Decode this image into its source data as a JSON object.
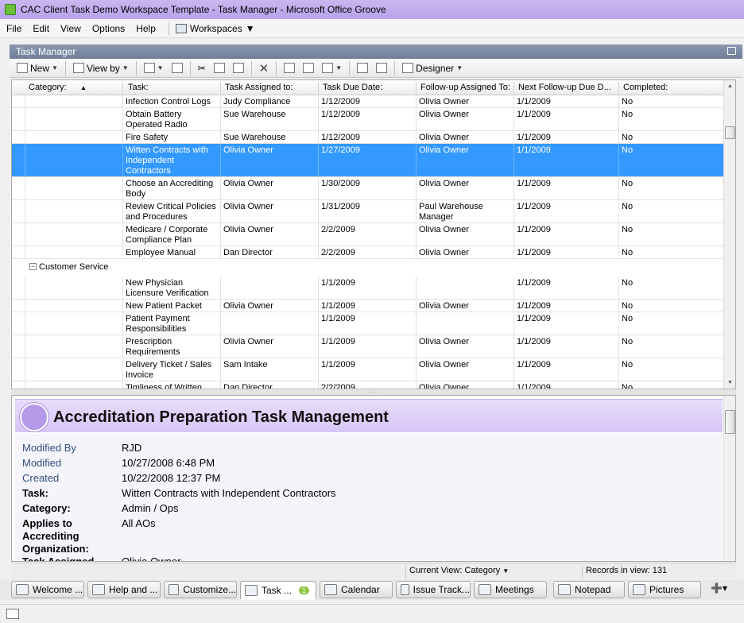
{
  "window": {
    "title": "CAC Client Task Demo Workspace Template - Task Manager - Microsoft Office Groove"
  },
  "menu": {
    "items": [
      "File",
      "Edit",
      "View",
      "Options",
      "Help"
    ],
    "workspaces": "Workspaces"
  },
  "tool": {
    "title": "Task Manager"
  },
  "toolbar": {
    "new_label": "New",
    "viewby_label": "View by",
    "designer_label": "Designer"
  },
  "columns": [
    "Category:",
    "Task:",
    "Task Assigned to:",
    "Task Due Date:",
    "Follow-up Assigned To:",
    "Next Follow-up Due D...",
    "Completed:"
  ],
  "rows_a": [
    {
      "task": "Infection Control Logs",
      "assigned": "Judy Compliance",
      "due": "1/12/2009",
      "followup": "Olivia Owner",
      "next": "1/1/2009",
      "completed": "No"
    },
    {
      "task": "Obtain Battery Operated Radio",
      "assigned": "Sue Warehouse",
      "due": "1/12/2009",
      "followup": "Olivia Owner",
      "next": "1/1/2009",
      "completed": "No"
    },
    {
      "task": "Fire Safety",
      "assigned": "Sue Warehouse",
      "due": "1/12/2009",
      "followup": "Olivia Owner",
      "next": "1/1/2009",
      "completed": "No"
    },
    {
      "task": "Witten Contracts with Independent Contractors",
      "assigned": "Olivia Owner",
      "due": "1/27/2009",
      "followup": "Olivia Owner",
      "next": "1/1/2009",
      "completed": "No"
    },
    {
      "task": "Choose an Accrediting Body",
      "assigned": "Olivia Owner",
      "due": "1/30/2009",
      "followup": "Olivia Owner",
      "next": "1/1/2009",
      "completed": "No"
    },
    {
      "task": "Review Critical Policies and Procedures",
      "assigned": "Olivia Owner",
      "due": "1/31/2009",
      "followup": "Paul Warehouse Manager",
      "next": "1/1/2009",
      "completed": "No"
    },
    {
      "task": "Medicare / Corporate Compliance Plan",
      "assigned": "Olivia Owner",
      "due": "2/2/2009",
      "followup": "Olivia Owner",
      "next": "1/1/2009",
      "completed": "No"
    },
    {
      "task": "Employee Manual",
      "assigned": "Dan Director",
      "due": "2/2/2009",
      "followup": "Olivia Owner",
      "next": "1/1/2009",
      "completed": "No"
    }
  ],
  "group": {
    "label": "Customer Service",
    "toggle": "−"
  },
  "rows_b": [
    {
      "task": "New Physician Licensure Verification",
      "assigned": "",
      "due": "1/1/2009",
      "followup": "",
      "next": "1/1/2009",
      "completed": "No"
    },
    {
      "task": "New Patient Packet",
      "assigned": "Olivia Owner",
      "due": "1/1/2009",
      "followup": "Olivia Owner",
      "next": "1/1/2009",
      "completed": "No"
    },
    {
      "task": "Patient Payment Responsibilities",
      "assigned": "",
      "due": "1/1/2009",
      "followup": "",
      "next": "1/1/2009",
      "completed": "No"
    },
    {
      "task": "Prescription Requirements",
      "assigned": "Olivia Owner",
      "due": "1/1/2009",
      "followup": "Olivia Owner",
      "next": "1/1/2009",
      "completed": "No"
    },
    {
      "task": "Delivery Ticket / Sales Invoice",
      "assigned": "Sam Intake",
      "due": "1/1/2009",
      "followup": "Olivia Owner",
      "next": "1/1/2009",
      "completed": "No"
    },
    {
      "task": "Timliness of Written",
      "assigned": "Dan Director",
      "due": "2/2/2009",
      "followup": "Olivia Owner",
      "next": "1/1/2009",
      "completed": "No"
    }
  ],
  "preview": {
    "title": "Accreditation Preparation Task Management",
    "fields": [
      {
        "label": "Modified By",
        "value": "RJD"
      },
      {
        "label": "Modified",
        "value": "10/27/2008 6:48 PM"
      },
      {
        "label": "Created",
        "value": "10/22/2008 12:37 PM"
      },
      {
        "label": "Task:",
        "value": "Witten Contracts with Independent Contractors"
      },
      {
        "label": "Category:",
        "value": "Admin / Ops"
      },
      {
        "label": "Applies to Accrediting Organization:",
        "value": "All AOs"
      },
      {
        "label": "Task Assigned",
        "value": "Olivia Owner"
      }
    ]
  },
  "status": {
    "current_view": "Current View: Category",
    "records": "Records in view: 131"
  },
  "tabs": [
    "Welcome ...",
    "Help and ...",
    "Customize...",
    "Task ...",
    "Calendar",
    "Issue Track...",
    "Meetings",
    "Notepad",
    "Pictures"
  ],
  "task_badge": "1"
}
